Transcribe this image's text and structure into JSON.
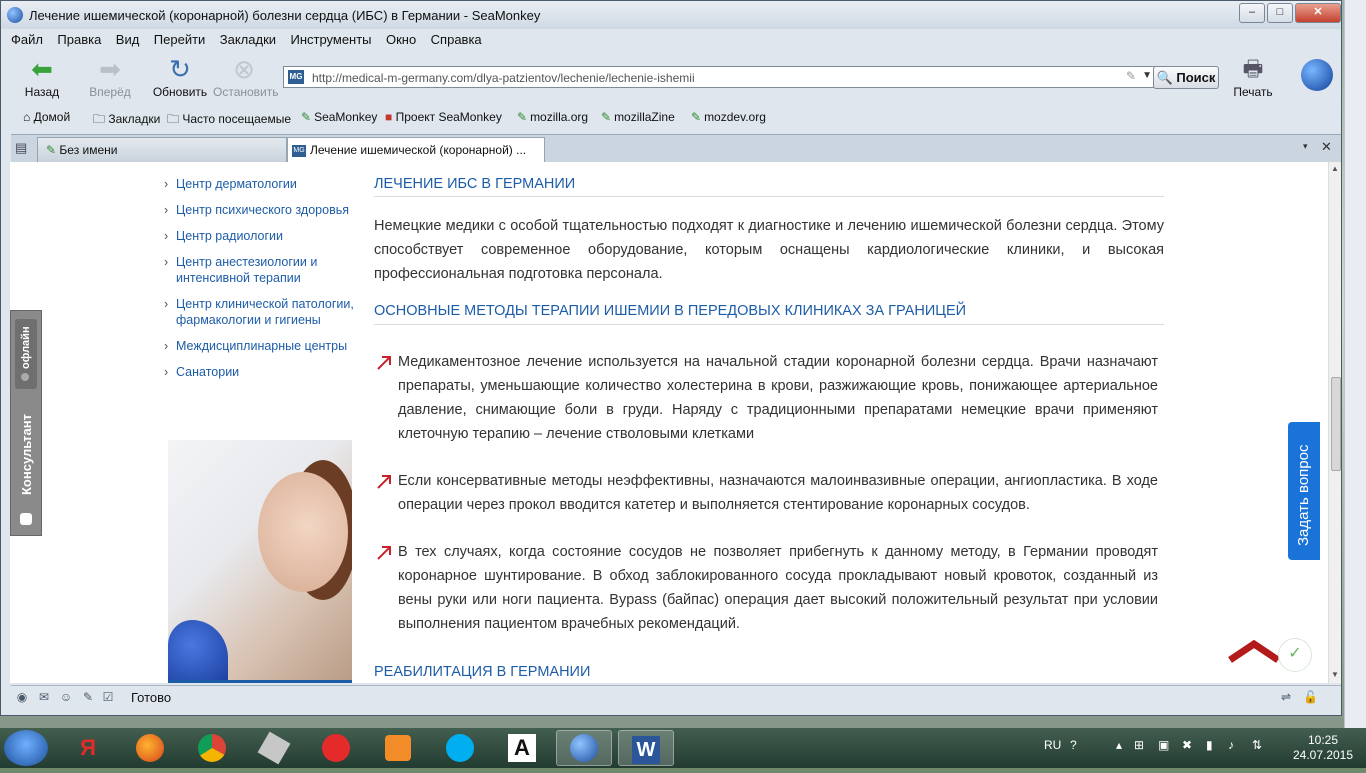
{
  "window": {
    "title": "Лечение ишемической (коронарной) болезни сердца (ИБС) в Германии - SeaMonkey",
    "min_label": "–",
    "max_label": "□",
    "close_label": "✕"
  },
  "menu": [
    "Файл",
    "Правка",
    "Вид",
    "Перейти",
    "Закладки",
    "Инструменты",
    "Окно",
    "Справка"
  ],
  "nav": {
    "back": "Назад",
    "forward": "Вперёд",
    "reload": "Обновить",
    "stop": "Остановить",
    "search": "Поиск",
    "print": "Печать",
    "site_icon": "MG",
    "url": "http://medical-m-germany.com/dlya-patzientov/lechenie/lechenie-ishemii"
  },
  "bookmarks": [
    "Домой",
    "Закладки",
    "Часто посещаемые",
    "SeaMonkey",
    "Проект SeaMonkey",
    "mozilla.org",
    "mozillaZine",
    "mozdev.org"
  ],
  "tabs": {
    "inactive": "Без имени",
    "active": "Лечение ишемической (коронарной) ..."
  },
  "sidebar": [
    "Центр дерматологии",
    "Центр психического здоровья",
    "Центр радиологии",
    "Центр анестезиологии и интенсивной терапии",
    "Центр клинической патологии, фармакологии и гигиены",
    "Междисциплинарные центры",
    "Санатории"
  ],
  "consultant": {
    "status": "офлайн",
    "label": "Консультант"
  },
  "article": {
    "h1": "ЛЕЧЕНИЕ ИБС В ГЕРМАНИИ",
    "p1": "Немецкие медики с особой тщательностью подходят к диагностике и лечению ишемической болезни сердца. Этому способствует современное оборудование, которым оснащены кардиологические клиники, и высокая профессиональная подготовка персонала.",
    "h2": "ОСНОВНЫЕ МЕТОДЫ ТЕРАПИИ ИШЕМИИ В ПЕРЕДОВЫХ КЛИНИКАХ ЗА ГРАНИЦЕЙ",
    "bullets": [
      "Медикаментозное лечение используется на начальной стадии коронарной болезни сердца. Врачи назначают препараты, уменьшающие количество холестерина в крови, разжижающие кровь, понижающее артериальное давление, снимающие боли в груди. Наряду с традиционными препаратами немецкие врачи применяют клеточную терапию – лечение стволовыми клетками",
      "Если консервативные методы неэффективны, назначаются малоинвазивные операции, ангиопластика. В ходе операции через прокол вводится катетер и выполняется стентирование коронарных сосудов.",
      "В тех случаях, когда состояние сосудов не позволяет прибегнуть к данному методу, в Германии проводят коронарное шунтирование. В обход заблокированного сосуда прокладывают новый кровоток, созданный из вены руки или ноги пациента. Bypass (байпас) операция дает высокий положительный результат при условии выполнения пациентом врачебных рекомендаций."
    ],
    "h3": "РЕАБИЛИТАЦИЯ В ГЕРМАНИИ"
  },
  "ask_button": "Задать вопрос",
  "status": "Готово",
  "taskbar": {
    "yandex_label": "Я",
    "word_label": "W",
    "font_label": "A",
    "lang": "RU",
    "time": "10:25",
    "date": "24.07.2015"
  },
  "colors": {
    "link": "#1d5da8",
    "ask_button": "#1a73d8",
    "arrow": "#c8232c"
  }
}
